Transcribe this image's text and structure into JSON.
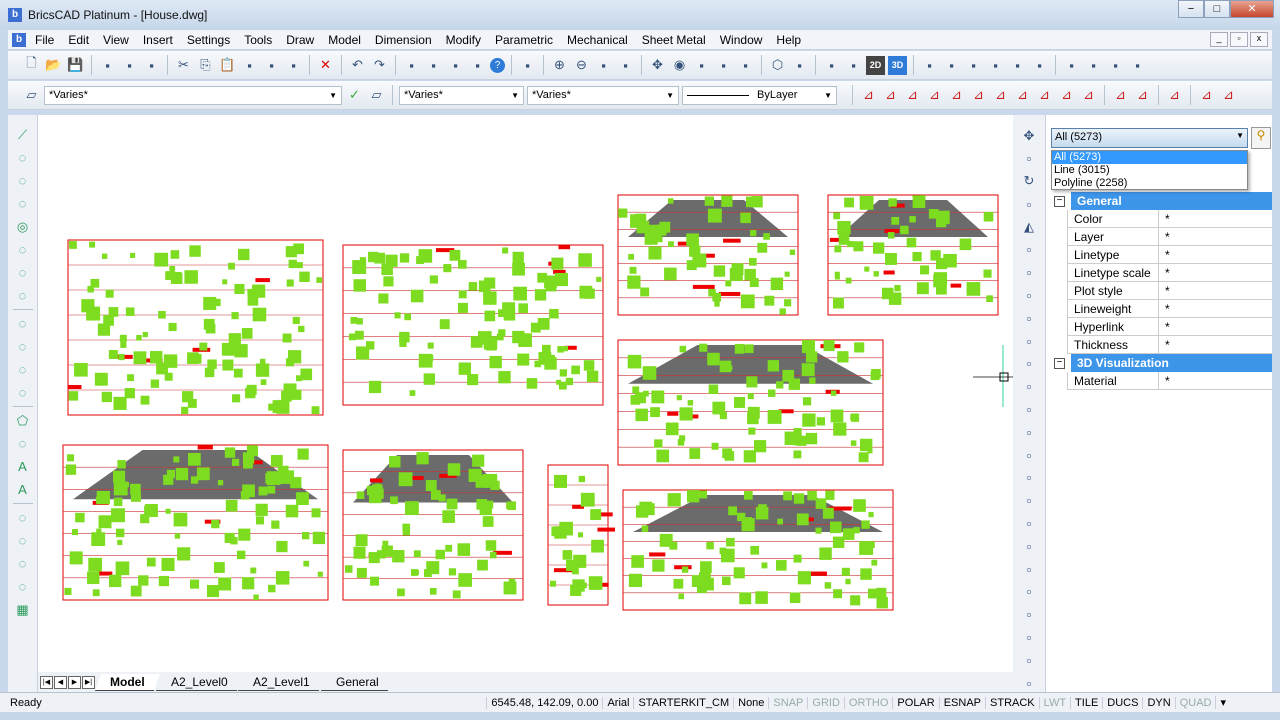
{
  "window": {
    "title": "BricsCAD Platinum - [House.dwg]",
    "minimize": "−",
    "maximize": "□",
    "close": "✕"
  },
  "menu": [
    "File",
    "Edit",
    "View",
    "Insert",
    "Settings",
    "Tools",
    "Draw",
    "Model",
    "Dimension",
    "Modify",
    "Parametric",
    "Mechanical",
    "Sheet Metal",
    "Window",
    "Help"
  ],
  "toolbar2": {
    "layer": "*Varies*",
    "color": "*Varies*",
    "linetype": "*Varies*",
    "lineweight": "ByLayer"
  },
  "properties": {
    "selection": "All (5273)",
    "options": [
      "All (5273)",
      "Line (3015)",
      "Polyline (2258)"
    ],
    "categories": [
      {
        "name": "General",
        "rows": [
          [
            "Color",
            "*"
          ],
          [
            "Layer",
            "*"
          ],
          [
            "Linetype",
            "*"
          ],
          [
            "Linetype scale",
            "*"
          ],
          [
            "Plot style",
            "*"
          ],
          [
            "Lineweight",
            "*"
          ],
          [
            "Hyperlink",
            "*"
          ],
          [
            "Thickness",
            "*"
          ]
        ]
      },
      {
        "name": "3D Visualization",
        "rows": [
          [
            "Material",
            "*"
          ]
        ]
      }
    ]
  },
  "tabs": [
    "Model",
    "A2_Level0",
    "A2_Level1",
    "General"
  ],
  "status": {
    "ready": "Ready",
    "coords": "6545.48, 142.09, 0.00",
    "font": "Arial",
    "dimstyle": "STARTERKIT_CM",
    "none": "None",
    "toggles": [
      {
        "l": "SNAP",
        "on": false
      },
      {
        "l": "GRID",
        "on": false
      },
      {
        "l": "ORTHO",
        "on": false
      },
      {
        "l": "POLAR",
        "on": true
      },
      {
        "l": "ESNAP",
        "on": true
      },
      {
        "l": "STRACK",
        "on": true
      },
      {
        "l": "LWT",
        "on": false
      },
      {
        "l": "TILE",
        "on": true
      },
      {
        "l": "DUCS",
        "on": true
      },
      {
        "l": "DYN",
        "on": true
      },
      {
        "l": "QUAD",
        "on": false
      }
    ]
  },
  "colors": {
    "grip": "#7ddc1f",
    "drawing_red": "#e00000",
    "roof": "#6b6b6b",
    "accent": "#3d95ea"
  }
}
